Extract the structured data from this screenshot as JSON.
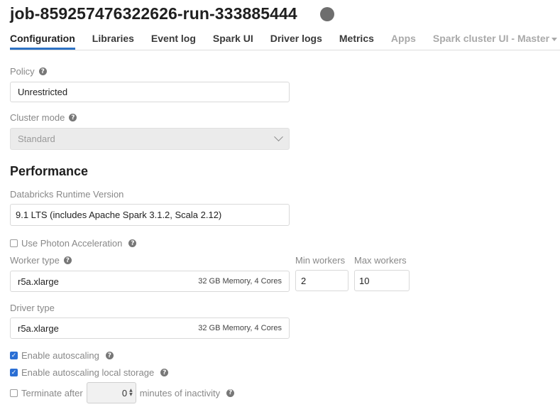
{
  "header": {
    "title": "job-859257476322626-run-333885444"
  },
  "tabs": [
    {
      "label": "Configuration"
    },
    {
      "label": "Libraries"
    },
    {
      "label": "Event log"
    },
    {
      "label": "Spark UI"
    },
    {
      "label": "Driver logs"
    },
    {
      "label": "Metrics"
    },
    {
      "label": "Apps"
    },
    {
      "label": "Spark cluster UI - Master"
    }
  ],
  "policy": {
    "label": "Policy",
    "value": "Unrestricted"
  },
  "cluster_mode": {
    "label": "Cluster mode",
    "value": "Standard"
  },
  "performance": {
    "heading": "Performance",
    "runtime_label": "Databricks Runtime Version",
    "runtime_value": "9.1 LTS (includes Apache Spark 3.1.2, Scala 2.12)",
    "photon_label": "Use Photon Acceleration",
    "worker_type_label": "Worker type",
    "worker_type_value": "r5a.xlarge",
    "worker_type_spec": "32 GB Memory, 4 Cores",
    "min_workers_label": "Min workers",
    "min_workers_value": "2",
    "max_workers_label": "Max workers",
    "max_workers_value": "10",
    "driver_type_label": "Driver type",
    "driver_type_value": "r5a.xlarge",
    "driver_type_spec": "32 GB Memory, 4 Cores"
  },
  "options": {
    "autoscaling_label": "Enable autoscaling",
    "autoscaling_local_label": "Enable autoscaling local storage",
    "terminate_label": "Terminate after",
    "terminate_value": "0",
    "terminate_suffix": "minutes of inactivity"
  },
  "colors": {
    "accent": "#2d72c4",
    "checkbox": "#2b6fd4",
    "status": "#6e6e6e"
  }
}
